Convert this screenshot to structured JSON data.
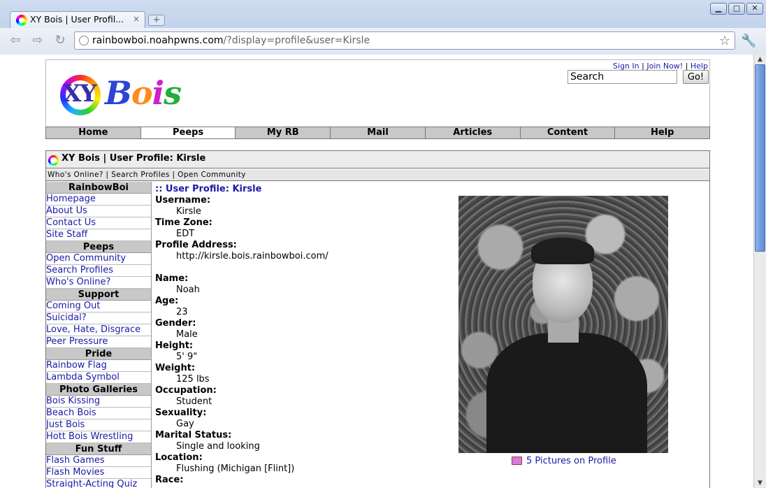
{
  "browser": {
    "tab_title": "XY Bois | User Profil...",
    "tab_close": "×",
    "new_tab": "+",
    "url_host": "rainbowboi.noahpwns.com",
    "url_path": "/?display=profile&user=Kirsle"
  },
  "header": {
    "logo_xy": "XY",
    "logo_bois": [
      "B",
      "o",
      "i",
      "s"
    ],
    "links": {
      "signin": "Sign In",
      "join": "Join Now!",
      "help": "Help"
    },
    "search_value": "Search",
    "search_button": "Go!"
  },
  "nav": [
    "Home",
    "Peeps",
    "My RB",
    "Mail",
    "Articles",
    "Content",
    "Help"
  ],
  "frame": {
    "title": "XY Bois | User Profile: Kirsle",
    "subnav": "Who's Online? | Search Profiles | Open Community"
  },
  "sidebar": {
    "sections": [
      {
        "head": "RainbowBoi",
        "links": [
          "Homepage",
          "About Us",
          "Contact Us",
          "Site Staff"
        ]
      },
      {
        "head": "Peeps",
        "links": [
          "Open Community",
          "Search Profiles",
          "Who's Online?"
        ]
      },
      {
        "head": "Support",
        "links": [
          "Coming Out",
          "Suicidal?",
          "Love, Hate, Disgrace",
          "Peer Pressure"
        ]
      },
      {
        "head": "Pride",
        "links": [
          "Rainbow Flag",
          "Lambda Symbol"
        ]
      },
      {
        "head": "Photo Galleries",
        "links": [
          "Bois Kissing",
          "Beach Bois",
          "Just Bois",
          "Hott Bois Wrestling"
        ]
      },
      {
        "head": "Fun Stuff",
        "links": [
          "Flash Games",
          "Flash Movies",
          "Straight-Acting Quiz"
        ]
      }
    ]
  },
  "profile": {
    "title": ":: User Profile: Kirsle",
    "fields": [
      {
        "label": "Username:",
        "value": "Kirsle"
      },
      {
        "label": "Time Zone:",
        "value": "EDT"
      },
      {
        "label": "Profile Address:",
        "value": "http://kirsle.bois.rainbowboi.com/"
      },
      {
        "gap": true
      },
      {
        "label": "Name:",
        "value": "Noah"
      },
      {
        "label": "Age:",
        "value": "23"
      },
      {
        "label": "Gender:",
        "value": "Male"
      },
      {
        "label": "Height:",
        "value": "5' 9\""
      },
      {
        "label": "Weight:",
        "value": "125 lbs"
      },
      {
        "label": "Occupation:",
        "value": "Student"
      },
      {
        "label": "Sexuality:",
        "value": "Gay"
      },
      {
        "label": "Marital Status:",
        "value": "Single and looking"
      },
      {
        "label": "Location:",
        "value": "Flushing (Michigan [Flint])"
      },
      {
        "label": "Race:",
        "value": ""
      }
    ],
    "photo_caption": "5 Pictures on Profile"
  }
}
